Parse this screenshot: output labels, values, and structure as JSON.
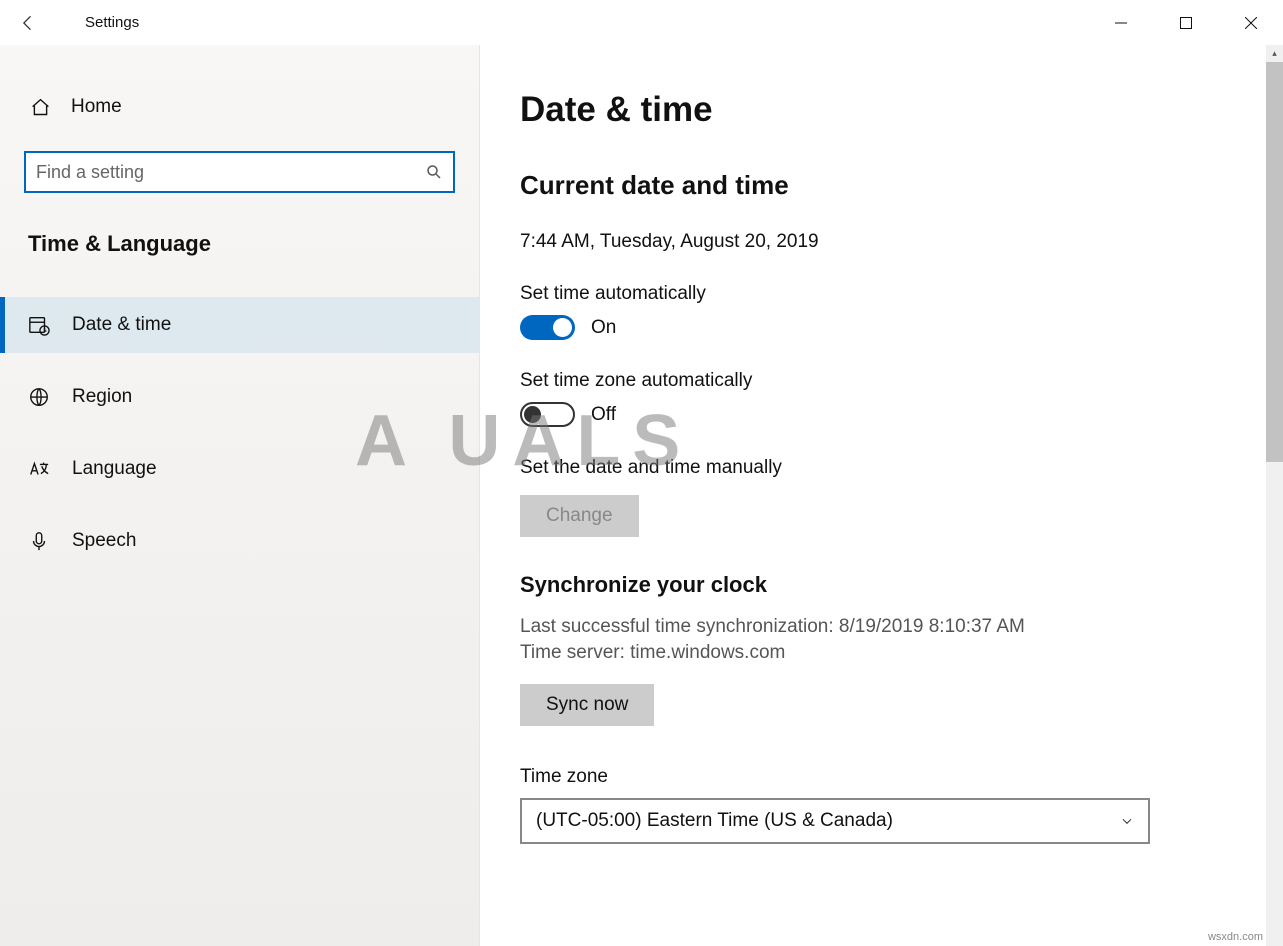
{
  "window": {
    "title": "Settings"
  },
  "sidebar": {
    "home": "Home",
    "search_placeholder": "Find a setting",
    "category": "Time & Language",
    "items": [
      {
        "label": "Date & time",
        "selected": true
      },
      {
        "label": "Region",
        "selected": false
      },
      {
        "label": "Language",
        "selected": false
      },
      {
        "label": "Speech",
        "selected": false
      }
    ]
  },
  "main": {
    "heading": "Date & time",
    "current_heading": "Current date and time",
    "current_value": "7:44 AM, Tuesday, August 20, 2019",
    "set_time_auto_label": "Set time automatically",
    "set_time_auto_state": "On",
    "set_tz_auto_label": "Set time zone automatically",
    "set_tz_auto_state": "Off",
    "manual_label": "Set the date and time manually",
    "change_button": "Change",
    "sync_heading": "Synchronize your clock",
    "sync_last": "Last successful time synchronization: 8/19/2019 8:10:37 AM",
    "sync_server": "Time server: time.windows.com",
    "sync_button": "Sync now",
    "timezone_label": "Time zone",
    "timezone_value": "(UTC-05:00) Eastern Time (US & Canada)"
  },
  "watermark": "wsxdn.com"
}
